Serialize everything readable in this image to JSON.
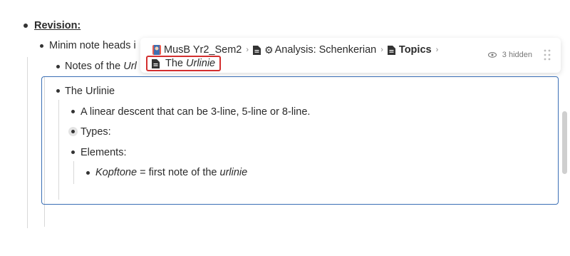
{
  "outline": {
    "revision_label": "Revision:",
    "minim_text": "Minim note heads i",
    "notes_prefix": "Notes of the ",
    "notes_italic": "Url"
  },
  "breadcrumb": {
    "items": [
      {
        "label": "MusB Yr2_Sem2",
        "icon": "book-icon"
      },
      {
        "label": "Analysis: Schenkerian",
        "icon": "gear-icon"
      },
      {
        "label": "Topics",
        "icon": "document-icon"
      }
    ],
    "current_prefix": "The ",
    "current_italic": "Urlinie",
    "hidden_label": "3 hidden"
  },
  "focus": {
    "title": "The Urlinie",
    "linear_descent": "A linear descent that can be 3-line, 5-line or 8-line.",
    "types": "Types:",
    "elements": "Elements:",
    "kopftone_italic": "Kopftone",
    "kopftone_mid": " = first note of the ",
    "kopftone_end": "urlinie"
  },
  "colors": {
    "focus_border": "#3b6fb5",
    "highlight_border": "#d32f2f"
  }
}
